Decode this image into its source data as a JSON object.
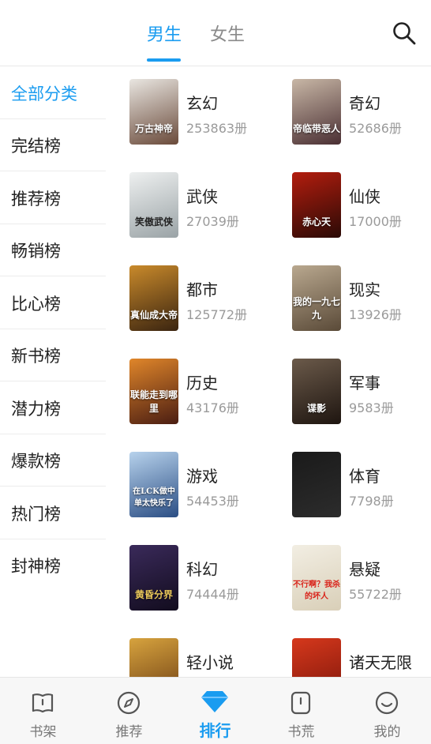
{
  "header": {
    "tabs": [
      {
        "label": "男生",
        "active": true
      },
      {
        "label": "女生",
        "active": false
      }
    ],
    "search_icon": "search-icon"
  },
  "sidebar": {
    "items": [
      {
        "label": "全部分类",
        "active": true
      },
      {
        "label": "完结榜"
      },
      {
        "label": "推荐榜"
      },
      {
        "label": "畅销榜"
      },
      {
        "label": "比心榜"
      },
      {
        "label": "新书榜"
      },
      {
        "label": "潜力榜"
      },
      {
        "label": "爆款榜"
      },
      {
        "label": "热门榜"
      },
      {
        "label": "封神榜"
      }
    ]
  },
  "categories": [
    {
      "name": "玄幻",
      "count": "253863册",
      "cover_text": "万古神帝",
      "cover_colors": [
        "#e9e6e1",
        "#6a4a3a"
      ]
    },
    {
      "name": "奇幻",
      "count": "52686册",
      "cover_text": "帝临带恶人",
      "cover_colors": [
        "#c8b7a6",
        "#4a2f33"
      ]
    },
    {
      "name": "武侠",
      "count": "27039册",
      "cover_text": "笑傲武侠",
      "cover_colors": [
        "#eef0f0",
        "#9aa3a6"
      ]
    },
    {
      "name": "仙侠",
      "count": "17000册",
      "cover_text": "赤心天",
      "cover_colors": [
        "#b31d0e",
        "#2a0a06"
      ]
    },
    {
      "name": "都市",
      "count": "125772册",
      "cover_text": "真仙成大帝",
      "cover_colors": [
        "#c98a2b",
        "#3a2410"
      ]
    },
    {
      "name": "现实",
      "count": "13926册",
      "cover_text": "我的一九七九",
      "cover_colors": [
        "#b9a88f",
        "#5a4a38"
      ]
    },
    {
      "name": "历史",
      "count": "43176册",
      "cover_text": "联能走到哪里",
      "cover_colors": [
        "#e0862a",
        "#4a1d12"
      ]
    },
    {
      "name": "军事",
      "count": "9583册",
      "cover_text": "谍影",
      "cover_colors": [
        "#6b5a4a",
        "#1e1510"
      ]
    },
    {
      "name": "游戏",
      "count": "54453册",
      "cover_text": "在LCK做中单太快乐了",
      "cover_colors": [
        "#b7d2ec",
        "#2b4e84"
      ]
    },
    {
      "name": "体育",
      "count": "7798册",
      "cover_text": "",
      "cover_colors": [
        "#1a1a1a",
        "#2c2c2c"
      ]
    },
    {
      "name": "科幻",
      "count": "74444册",
      "cover_text": "黄昏分界",
      "cover_colors": [
        "#3a2a5a",
        "#120c1e"
      ]
    },
    {
      "name": "悬疑",
      "count": "55722册",
      "cover_text": "不行啊？我杀的坏人",
      "cover_colors": [
        "#f2eee3",
        "#d9cfb8"
      ]
    },
    {
      "name": "轻小说",
      "count": "",
      "cover_text": "",
      "cover_colors": [
        "#d7a33e",
        "#6a3b12"
      ]
    },
    {
      "name": "诸天无限",
      "count": "",
      "cover_text": "",
      "cover_colors": [
        "#d6381c",
        "#7a150a"
      ]
    }
  ],
  "bottom_nav": [
    {
      "label": "书架",
      "icon": "bookshelf-icon",
      "active": false
    },
    {
      "label": "推荐",
      "icon": "compass-icon",
      "active": false
    },
    {
      "label": "排行",
      "icon": "diamond-icon",
      "active": true
    },
    {
      "label": "书荒",
      "icon": "book-alert-icon",
      "active": false
    },
    {
      "label": "我的",
      "icon": "smile-icon",
      "active": false
    }
  ],
  "colors": {
    "accent": "#1a9cf0",
    "text": "#222222",
    "muted": "#9a9a9a"
  }
}
